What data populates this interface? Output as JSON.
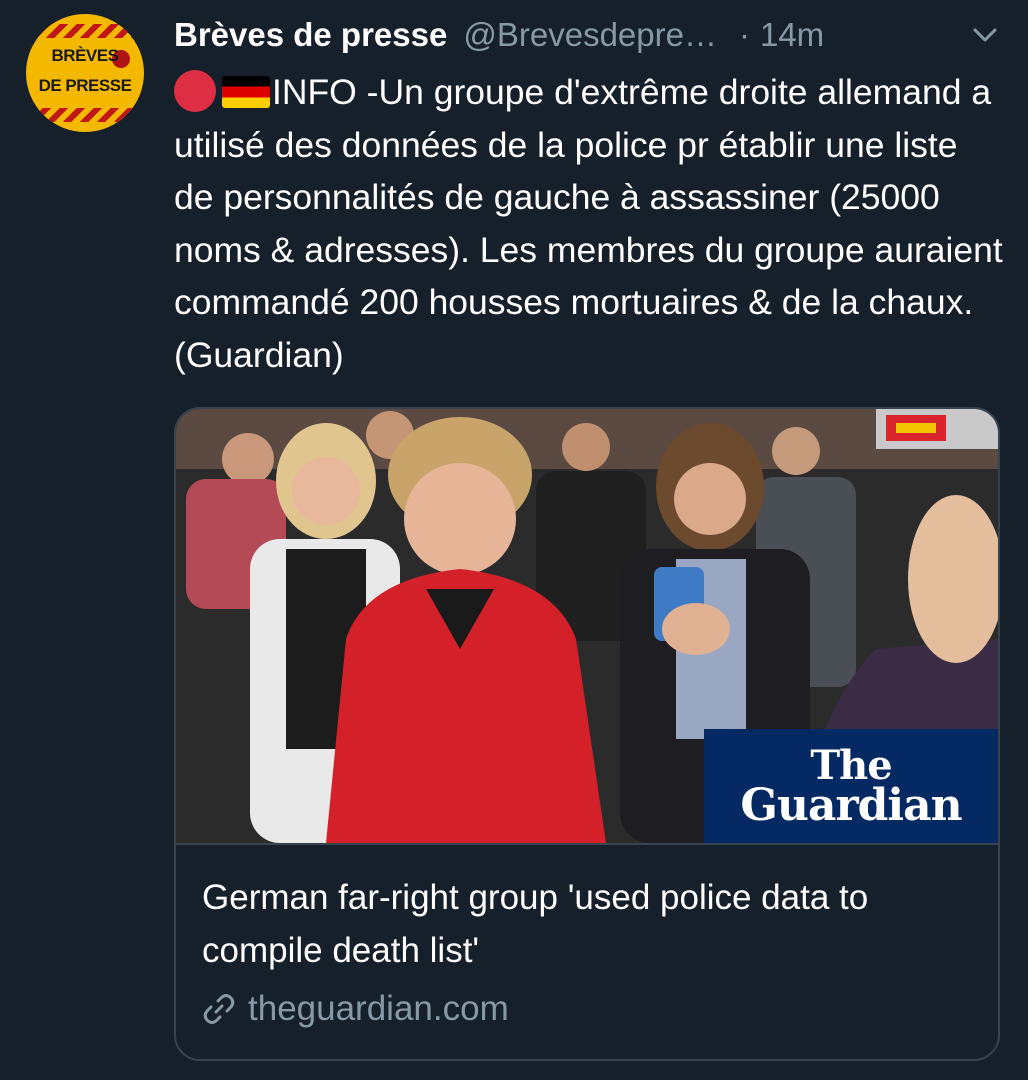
{
  "tweet": {
    "author": {
      "display_name": "Brèves de presse",
      "handle": "@Brevesdepre…",
      "avatar_text_line1": "BRÈVES",
      "avatar_text_line2": "DE PRESSE"
    },
    "separator": "·",
    "time": "14m",
    "text": "INFO -Un groupe d'extrême droite allemand a utilisé des données de la police pr établir une liste de personnalités de gauche à assassiner (25000 noms & adresses). Les membres du groupe auraient commandé 200 housses mortuaires & de la chaux. (Guardian)",
    "emoji": [
      "red-circle",
      "germany-flag"
    ],
    "card": {
      "image_logo_line1": "The",
      "image_logo_line2": "Guardian",
      "title": "German far-right group 'used police data to compile death list'",
      "domain": "theguardian.com"
    }
  },
  "colors": {
    "background": "#15202b",
    "text_primary": "#ffffff",
    "text_secondary": "#8899a6",
    "card_border": "#38444d",
    "guardian_blue": "#052962"
  }
}
